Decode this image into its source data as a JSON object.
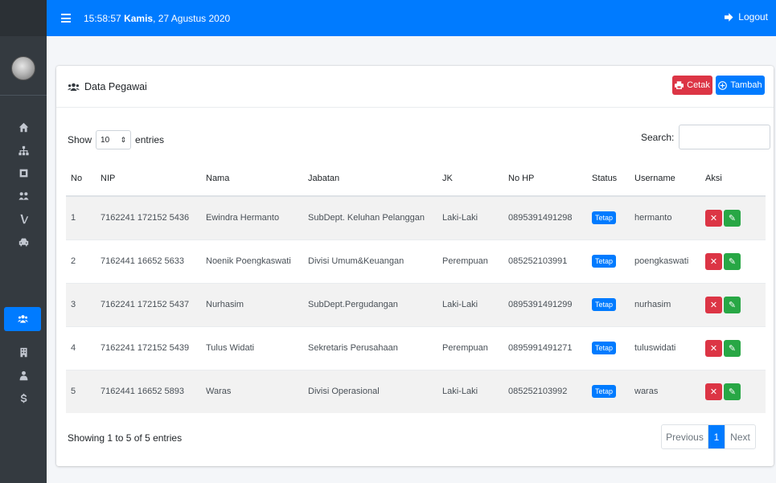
{
  "header": {
    "time": "15:58:57",
    "day": "Kamis",
    "date": ", 27 Agustus 2020",
    "logout_label": "Logout"
  },
  "sidebar": {
    "items": [
      {
        "icon": "home-icon"
      },
      {
        "icon": "sitemap-icon"
      },
      {
        "icon": "square-icon"
      },
      {
        "icon": "users-group-icon"
      },
      {
        "icon": "route-icon"
      },
      {
        "icon": "car-icon"
      },
      {
        "icon": "users-icon",
        "active": true
      },
      {
        "icon": "building-icon"
      },
      {
        "icon": "user-tie-icon"
      },
      {
        "icon": "dollar-icon"
      }
    ]
  },
  "card": {
    "title": "Data Pegawai",
    "cetak_label": "Cetak",
    "tambah_label": "Tambah"
  },
  "table_controls": {
    "show_label": "Show",
    "length_value": "10",
    "entries_label": "entries",
    "search_label": "Search:",
    "search_value": ""
  },
  "table": {
    "columns": [
      "No",
      "NIP",
      "Nama",
      "Jabatan",
      "JK",
      "No HP",
      "Status",
      "Username",
      "Aksi"
    ],
    "rows": [
      {
        "no": "1",
        "nip": "7162241 172152 5436",
        "nama": "Ewindra Hermanto",
        "jabatan": "SubDept. Keluhan Pelanggan",
        "jk": "Laki-Laki",
        "hp": "0895391491298",
        "status": "Tetap",
        "username": "hermanto"
      },
      {
        "no": "2",
        "nip": "7162441 16652 5633",
        "nama": "Noenik Poengkaswati",
        "jabatan": "Divisi Umum&Keuangan",
        "jk": "Perempuan",
        "hp": "085252103991",
        "status": "Tetap",
        "username": "poengkaswati"
      },
      {
        "no": "3",
        "nip": "7162241 172152 5437",
        "nama": "Nurhasim",
        "jabatan": "SubDept.Pergudangan",
        "jk": "Laki-Laki",
        "hp": "0895391491299",
        "status": "Tetap",
        "username": "nurhasim"
      },
      {
        "no": "4",
        "nip": "7162241 172152 5439",
        "nama": "Tulus Widati",
        "jabatan": "Sekretaris Perusahaan",
        "jk": "Perempuan",
        "hp": "0895991491271",
        "status": "Tetap",
        "username": "tuluswidati"
      },
      {
        "no": "5",
        "nip": "7162441 16652 5893",
        "nama": "Waras",
        "jabatan": "Divisi Operasional",
        "jk": "Laki-Laki",
        "hp": "085252103992",
        "status": "Tetap",
        "username": "waras"
      }
    ]
  },
  "footer": {
    "info": "Showing 1 to 5 of 5 entries",
    "prev_label": "Previous",
    "current_page": "1",
    "next_label": "Next"
  },
  "colors": {
    "primary": "#007bff",
    "danger": "#dc3545",
    "success": "#28a745",
    "sidebar": "#343a40"
  }
}
